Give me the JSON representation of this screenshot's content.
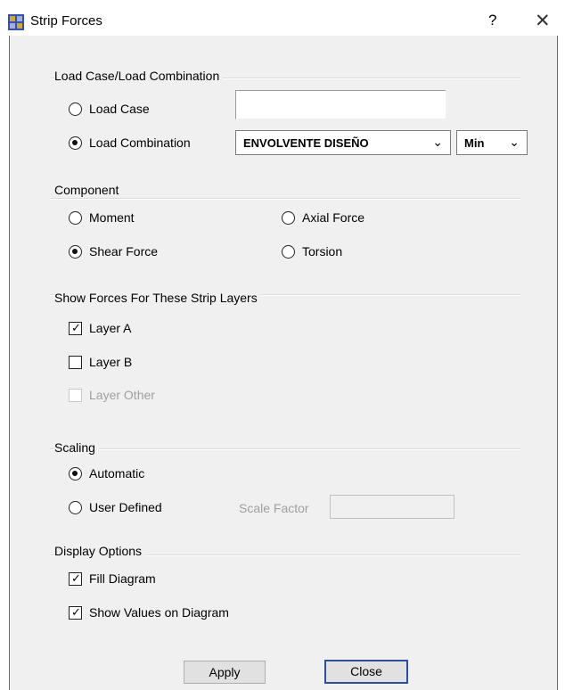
{
  "window": {
    "title": "Strip Forces",
    "help_label": "?",
    "close_glyph": "✕"
  },
  "load_group": {
    "title": "Load Case/Load Combination",
    "load_case_label": "Load Case",
    "load_combination_label": "Load Combination",
    "selected": "Load Combination",
    "combination_value": "ENVOLVENTE DISEÑO",
    "extreme_value": "Min"
  },
  "component_group": {
    "title": "Component",
    "moment_label": "Moment",
    "axial_label": "Axial Force",
    "shear_label": "Shear Force",
    "torsion_label": "Torsion",
    "selected": "Shear Force"
  },
  "layers_group": {
    "title": "Show Forces For These Strip Layers",
    "layer_a": {
      "label": "Layer A",
      "checked": true
    },
    "layer_b": {
      "label": "Layer B",
      "checked": false
    },
    "layer_other": {
      "label": "Layer Other",
      "checked": false,
      "enabled": false
    }
  },
  "scaling_group": {
    "title": "Scaling",
    "automatic_label": "Automatic",
    "user_defined_label": "User Defined",
    "selected": "Automatic",
    "scale_factor_label": "Scale Factor",
    "scale_factor_value": ""
  },
  "display_group": {
    "title": "Display Options",
    "fill_diagram": {
      "label": "Fill Diagram",
      "checked": true
    },
    "show_values": {
      "label": "Show Values on Diagram",
      "checked": true
    }
  },
  "buttons": {
    "apply": "Apply",
    "close": "Close"
  },
  "colors": {
    "default_button_border": "#2c4ea0",
    "dialog_bg": "#f0f0f0"
  }
}
